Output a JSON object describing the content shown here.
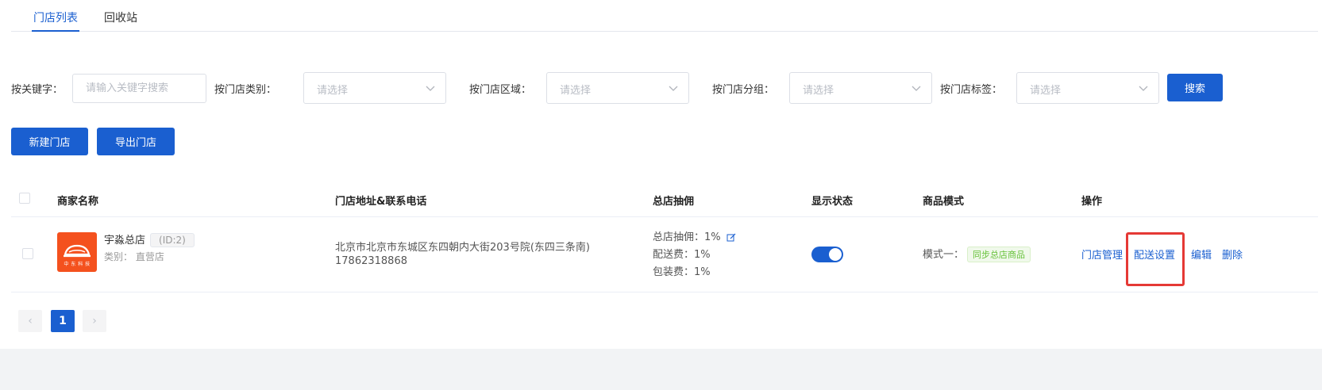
{
  "tabs": [
    {
      "label": "门店列表",
      "active": true
    },
    {
      "label": "回收站",
      "active": false
    }
  ],
  "filters": {
    "keyword_label": "按关键字：",
    "keyword_placeholder": "请输入关键字搜索",
    "category_label": "按门店类别：",
    "region_label": "按门店区域：",
    "group_label": "按门店分组：",
    "tag_label": "按门店标签：",
    "select_placeholder": "请选择",
    "search_button": "搜索"
  },
  "actions": {
    "new_store": "新建门店",
    "export_store": "导出门店"
  },
  "table": {
    "headers": {
      "merchant": "商家名称",
      "address": "门店地址&联系电话",
      "commission": "总店抽佣",
      "display_status": "显示状态",
      "product_mode": "商品模式",
      "operations": "操作"
    },
    "rows": [
      {
        "name": "宇淼总店",
        "id_tag": "(ID:2)",
        "category": "类别：  直营店",
        "logo_text": "中 东 科 技",
        "address": "北京市北京市东城区东四朝内大街203号院(东四三条南)",
        "phone": "17862318868",
        "commission": "总店抽佣：1%",
        "delivery_fee": "配送费：1%",
        "packing_fee": "包装费：1%",
        "display_on": true,
        "mode_label": "模式一：",
        "mode_tag": "同步总店商品",
        "ops": {
          "manage": "门店管理",
          "delivery": "配送设置",
          "edit": "编辑",
          "delete": "删除"
        }
      }
    ]
  },
  "pagination": {
    "prev": "‹",
    "current": "1",
    "next": "›"
  },
  "colors": {
    "primary": "#1a5fd0",
    "highlight": "#e53935",
    "logo": "#f4511e",
    "tag_green": "#67c23a"
  }
}
